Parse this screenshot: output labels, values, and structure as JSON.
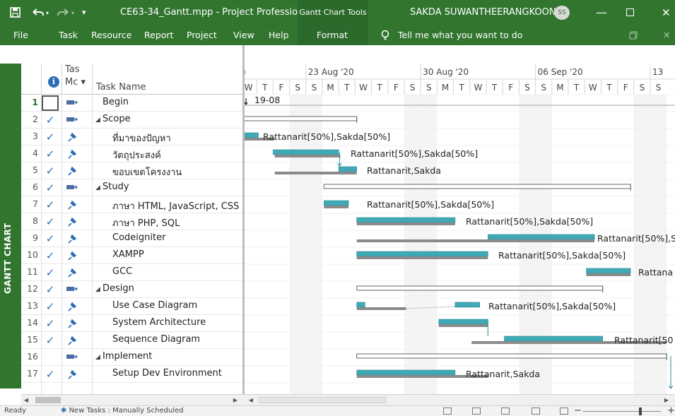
{
  "titlebar": {
    "doc_title": "CE63-34_Gantt.mpp  -  Project Professio...",
    "context_title": "Gantt Chart Tools",
    "user_name": "SAKDA SUWANTHEERANGKOON",
    "user_initials": "SS",
    "minimize": "—",
    "close": "✕",
    "qat_dropdown": "▾"
  },
  "ribbon": {
    "tabs": [
      "File",
      "Task",
      "Resource",
      "Report",
      "Project",
      "View",
      "Help"
    ],
    "context_tab": "Format",
    "tell_me": "Tell me what you want to do"
  },
  "side_label": "GANTT CHART",
  "grid": {
    "header_mode": "Tas\nMc ▾",
    "header_name": "Task Name",
    "info_glyph": "i",
    "rows": [
      {
        "id": "1",
        "done": false,
        "mode": "auto",
        "level": 0,
        "summary": false,
        "name": "Begin",
        "selected": true
      },
      {
        "id": "2",
        "done": true,
        "mode": "auto",
        "level": 1,
        "summary": true,
        "name": "Scope"
      },
      {
        "id": "3",
        "done": true,
        "mode": "manual",
        "level": 2,
        "summary": false,
        "name": "ที่มาของปัญหา"
      },
      {
        "id": "4",
        "done": true,
        "mode": "manual",
        "level": 2,
        "summary": false,
        "name": "วัตถุประสงค์"
      },
      {
        "id": "5",
        "done": true,
        "mode": "manual",
        "level": 2,
        "summary": false,
        "name": "ขอบเขตโครงงาน"
      },
      {
        "id": "6",
        "done": true,
        "mode": "auto",
        "level": 1,
        "summary": true,
        "name": "Study"
      },
      {
        "id": "7",
        "done": true,
        "mode": "manual",
        "level": 2,
        "summary": false,
        "name": "ภาษา HTML, JavaScript, CSS"
      },
      {
        "id": "8",
        "done": true,
        "mode": "manual",
        "level": 2,
        "summary": false,
        "name": "ภาษา PHP, SQL"
      },
      {
        "id": "9",
        "done": true,
        "mode": "manual",
        "level": 2,
        "summary": false,
        "name": "Codeigniter"
      },
      {
        "id": "10",
        "done": true,
        "mode": "manual",
        "level": 2,
        "summary": false,
        "name": "XAMPP"
      },
      {
        "id": "11",
        "done": true,
        "mode": "manual",
        "level": 2,
        "summary": false,
        "name": "GCC"
      },
      {
        "id": "12",
        "done": true,
        "mode": "auto",
        "level": 1,
        "summary": true,
        "name": "Design"
      },
      {
        "id": "13",
        "done": true,
        "mode": "manual",
        "level": 2,
        "summary": false,
        "name": "Use Case Diagram"
      },
      {
        "id": "14",
        "done": true,
        "mode": "manual",
        "level": 2,
        "summary": false,
        "name": "System Architecture"
      },
      {
        "id": "15",
        "done": true,
        "mode": "manual",
        "level": 2,
        "summary": false,
        "name": "Sequence Diagram"
      },
      {
        "id": "16",
        "done": false,
        "mode": "auto",
        "level": 1,
        "summary": true,
        "name": "Implement"
      },
      {
        "id": "17",
        "done": true,
        "mode": "manual",
        "level": 2,
        "summary": false,
        "name": "Setup Dev Environment"
      }
    ]
  },
  "timescale": {
    "weeks": [
      "23 Aug '20",
      "30 Aug '20",
      "06 Sep '20",
      "13"
    ],
    "days": [
      "W",
      "T",
      "F",
      "S",
      "S",
      "M",
      "T",
      "W",
      "T",
      "F",
      "S",
      "S",
      "M",
      "T",
      "W",
      "T",
      "F",
      "S",
      "S",
      "M",
      "T",
      "W",
      "T",
      "F",
      "S",
      "S"
    ]
  },
  "gantt_labels": {
    "begin_date": "19-08",
    "r3": "Rattanarit[50%],Sakda[50%]",
    "r4": "Rattanarit[50%],Sakda[50%]",
    "r5": "Rattanarit,Sakda",
    "r7": "Rattanarit[50%],Sakda[50%]",
    "r8": "Rattanarit[50%],Sakda[50%]",
    "r9": "Rattanarit[50%],S",
    "r10": "Rattanarit[50%],Sakda[50%]",
    "r11": "Rattana",
    "r13": "Rattanarit[50%],Sakda[50%]",
    "r15": "Rattanarit[50",
    "r17": "Rattanarit,Sakda"
  },
  "status": {
    "ready": "Ready",
    "new_tasks": "New Tasks : Manually Scheduled"
  },
  "colors": {
    "brand": "#31752f",
    "task_bar": "#3fa9b5",
    "baseline_bar": "#8a8a8a",
    "info_blue": "#2d6db5"
  }
}
